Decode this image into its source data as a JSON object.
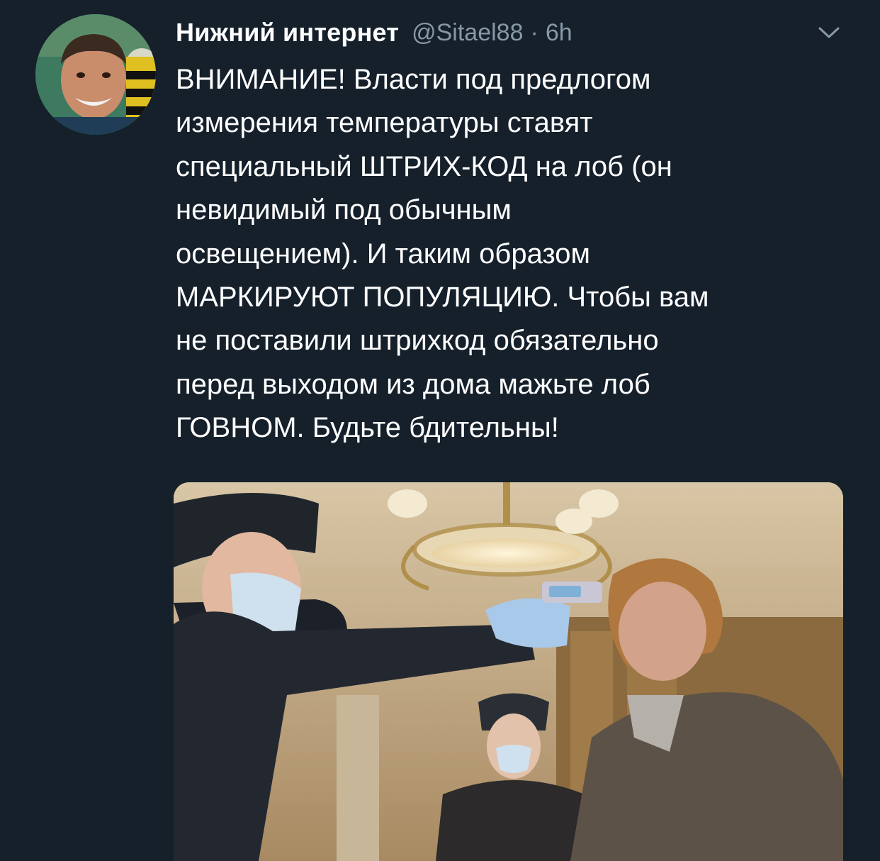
{
  "tweet": {
    "author_name": "Нижний интернет",
    "handle": "@Sitael88",
    "separator": "·",
    "time": "6h",
    "text_lines": [
      "ВНИМАНИЕ! Власти под предлогом",
      "измерения температуры ставят",
      "специальный ШТРИХ-КОД на лоб (он",
      "невидимый под обычным",
      "освещением). И таким образом",
      "МАРКИРУЮТ ПОПУЛЯЦИЮ. Чтобы вам",
      "не поставили штрихкод обязательно",
      "перед выходом из дома мажьте лоб",
      "ГОВНОМ. Будьте бдительны!"
    ]
  },
  "icons": {
    "menu": "chevron-down-icon",
    "avatar": "avatar"
  },
  "colors": {
    "background": "#15202b",
    "text": "#ffffff",
    "secondary_text": "#8899a6"
  }
}
